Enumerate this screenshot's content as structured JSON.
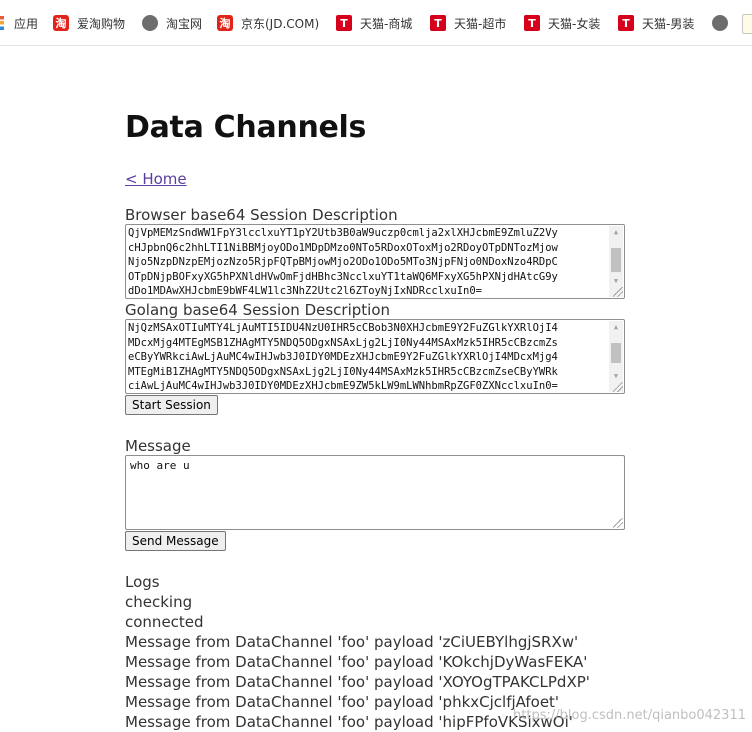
{
  "bookmarks": [
    {
      "label": "应用",
      "icon": "apps-icon"
    },
    {
      "label": "爱淘购物",
      "icon": "taobao-icon"
    },
    {
      "label": "淘宝网",
      "icon": "globe-icon"
    },
    {
      "label": "京东(JD.COM)",
      "icon": "taobao-icon"
    },
    {
      "label": "天猫-商城",
      "icon": "tmall-icon"
    },
    {
      "label": "天猫-超市",
      "icon": "tmall-icon"
    },
    {
      "label": "天猫-女装",
      "icon": "tmall-icon"
    },
    {
      "label": "天猫-男装",
      "icon": "tmall-icon"
    }
  ],
  "page": {
    "title": "Data Channels",
    "home_link": "< Home"
  },
  "browser_sd": {
    "label": "Browser base64 Session Description",
    "lines": [
      "QjVpMEMzSndWW1FpY3lcclxuYT1pY2Utb3B0aW9uczp0cmlja2xlXHJcbmE9ZmluZ2Vy",
      "cHJpbnQ6c2hhLTI1NiBBMjoyODo1MDpDMzo0NTo5RDoxOToxMjo2RDoyOTpDNTozMjow",
      "Njo5NzpDNzpEMjozNzo5RjpFQTpBMjowMjo2ODo1ODo5MTo3NjpFNjo0NDoxNzo4RDpC",
      "OTpDNjpBOFxyXG5hPXNldHVwOmFjdHBhc3NcclxuYT1taWQ6MFxyXG5hPXNjdHAtcG9y",
      "dDo1MDAwXHJcbmE9bWF4LW1lc3NhZ2Utc2l6ZToyNjIxNDRcclxuIn0="
    ]
  },
  "golang_sd": {
    "label": "Golang base64 Session Description",
    "lines": [
      "NjQzMSAxOTIuMTY4LjAuMTI5IDU4NzU0IHR5cCBob3N0XHJcbmE9Y2FuZGlkYXRlOjI4",
      "MDcxMjg4MTEgMSB1ZHAgMTY5NDQ5ODgxNSAxLjg2LjI0Ny44MSAxMzk5IHR5cCBzcmZs",
      "eCByYWRkciAwLjAuMC4wIHJwb3J0IDY0MDEzXHJcbmE9Y2FuZGlkYXRlOjI4MDcxMjg4",
      "MTEgMiB1ZHAgMTY5NDQ5ODgxNSAxLjg2LjI0Ny44MSAxMzk5IHR5cCBzcmZseCByYWRk",
      "ciAwLjAuMC4wIHJwb3J0IDY0MDEzXHJcbmE9ZW5kLW9mLWNhbmRpZGF0ZXNcclxuIn0="
    ]
  },
  "start_session_label": "Start Session",
  "message": {
    "label": "Message",
    "value": "who are u"
  },
  "send_message_label": "Send Message",
  "logs": {
    "label": "Logs",
    "entries": [
      "checking",
      "connected",
      "Message from DataChannel 'foo' payload 'zCiUEBYlhgjSRXw'",
      "Message from DataChannel 'foo' payload 'KOkchjDyWasFEKA'",
      "Message from DataChannel 'foo' payload 'XOYOgTPAKCLPdXP'",
      "Message from DataChannel 'foo' payload 'phkxCjclfjAfoet'",
      "Message from DataChannel 'foo' payload 'hipFPfoVKSixwOi'"
    ]
  },
  "watermark": "https://blog.csdn.net/qianbo042311"
}
